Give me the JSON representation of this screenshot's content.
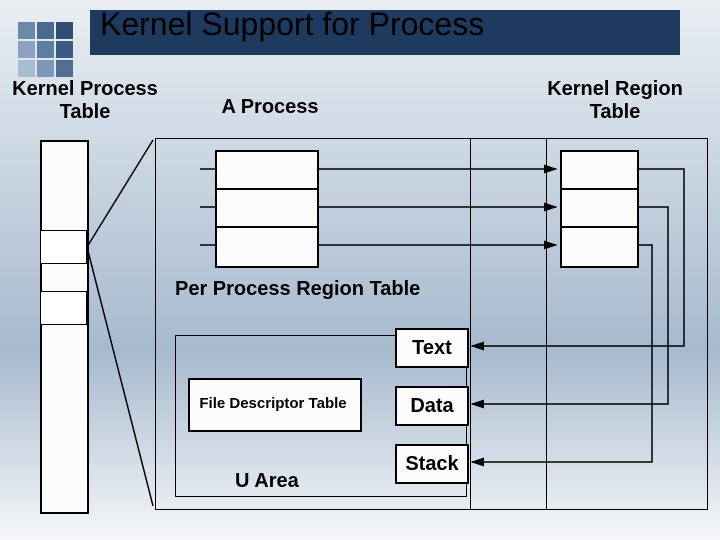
{
  "title": "Kernel Support for Process",
  "labels": {
    "kpt": "Kernel Process\nTable",
    "aprocess": "A Process",
    "krt": "Kernel Region\nTable",
    "pprt": "Per Process Region Table",
    "fdt": "File Descriptor Table",
    "uarea": "U Area"
  },
  "segments": {
    "text": "Text",
    "data": "Data",
    "stack": "Stack"
  },
  "deco_colors": {
    "a": "#6d89a8",
    "b": "#4a6b8f",
    "c": "#2e4e73",
    "d": "#8aa2bd",
    "e": "#5d7ea2",
    "f": "#3a5c82",
    "g": "#a9bdd2",
    "h": "#7c98b6",
    "i": "#516e91"
  }
}
